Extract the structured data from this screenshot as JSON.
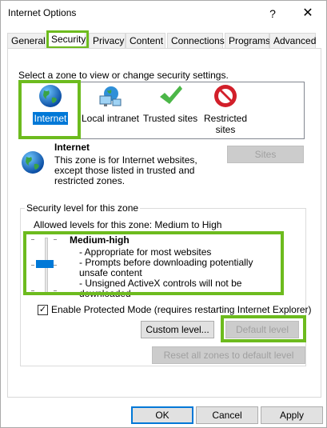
{
  "window": {
    "title": "Internet Options",
    "help_label": "?",
    "close_label": "✕"
  },
  "tabs": [
    {
      "label": "General"
    },
    {
      "label": "Security"
    },
    {
      "label": "Privacy"
    },
    {
      "label": "Content"
    },
    {
      "label": "Connections"
    },
    {
      "label": "Programs"
    },
    {
      "label": "Advanced"
    }
  ],
  "security": {
    "select_label": "Select a zone to view or change security settings.",
    "zones": [
      {
        "label": "Internet",
        "icon": "globe-icon",
        "selected": true
      },
      {
        "label": "Local intranet",
        "icon": "network-computer-icon",
        "selected": false
      },
      {
        "label": "Trusted sites",
        "icon": "checkmark-icon",
        "selected": false
      },
      {
        "label": "Restricted sites",
        "icon": "no-entry-icon",
        "selected": false
      }
    ],
    "zone_title": "Internet",
    "zone_description": "This zone is for Internet websites, except those listed in trusted and restricted zones.",
    "sites_label": "Sites",
    "level_group_title": "Security level for this zone",
    "allowed_levels": "Allowed levels for this zone: Medium to High",
    "level_name": "Medium-high",
    "level_points": [
      "- Appropriate for most websites",
      "- Prompts before downloading potentially unsafe content",
      "- Unsigned ActiveX controls will not be downloaded"
    ],
    "protected_mode_label": "Enable Protected Mode (requires restarting Internet Explorer)",
    "protected_mode_checked": true,
    "custom_level_label": "Custom level...",
    "default_level_label": "Default level",
    "reset_all_label": "Reset all zones to default level"
  },
  "footer": {
    "ok_label": "OK",
    "cancel_label": "Cancel",
    "apply_label": "Apply"
  },
  "colors": {
    "highlight": "#6dbb1e",
    "selection": "#0078d7"
  }
}
